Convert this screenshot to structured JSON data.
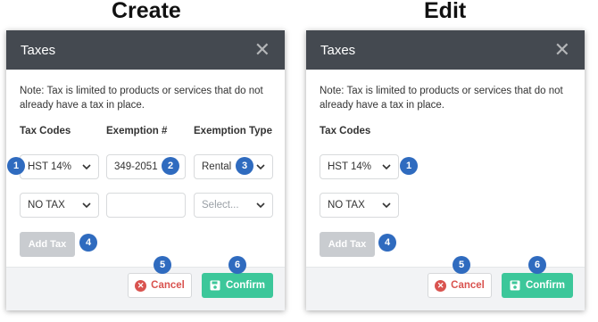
{
  "headings": {
    "create": "Create",
    "edit": "Edit"
  },
  "create": {
    "modal_title": "Taxes",
    "note": "Note: Tax is limited to products or services that do not already have a tax in place.",
    "columns": {
      "tax_codes": "Tax Codes",
      "exemption_number": "Exemption #",
      "exemption_type": "Exemption Type"
    },
    "rows": [
      {
        "tax_code": "HST 14%",
        "exemption_number": "349-2051",
        "exemption_type": "Rental"
      },
      {
        "tax_code": "NO TAX",
        "exemption_number": "",
        "exemption_type_placeholder": "Select..."
      }
    ],
    "add_tax_label": "Add Tax",
    "cancel_label": "Cancel",
    "confirm_label": "Confirm"
  },
  "edit": {
    "modal_title": "Taxes",
    "note": "Note: Tax is limited to products or services that do not already have a tax in place.",
    "columns": {
      "tax_codes": "Tax Codes"
    },
    "rows": [
      {
        "tax_code": "HST 14%"
      },
      {
        "tax_code": "NO TAX"
      }
    ],
    "add_tax_label": "Add Tax",
    "cancel_label": "Cancel",
    "confirm_label": "Confirm"
  },
  "badges": {
    "b1": "1",
    "b2": "2",
    "b3": "3",
    "b4": "4",
    "b5": "5",
    "b6": "6"
  },
  "colors": {
    "header_bg": "#444950",
    "confirm_bg": "#3cc79a",
    "cancel_text": "#d9534f",
    "badge_bg": "#2f6bbf",
    "add_tax_bg": "#c9ccd0"
  },
  "icons": {
    "close": "close-icon",
    "chevron": "chevron-down-icon",
    "cancel": "x-circle-icon",
    "confirm": "save-icon"
  }
}
